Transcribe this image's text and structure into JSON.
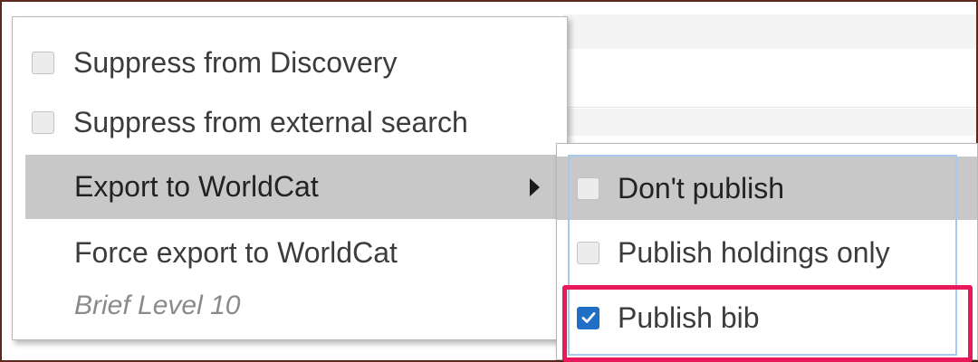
{
  "main_menu": {
    "items": [
      {
        "label": "Suppress from Discovery",
        "checked": false
      },
      {
        "label": "Suppress from external search",
        "checked": false
      },
      {
        "label": "Export to WorldCat",
        "has_submenu": true,
        "active": true
      },
      {
        "label": "Force export to WorldCat"
      },
      {
        "label": "Brief Level 10",
        "disabled": true
      }
    ]
  },
  "submenu": {
    "items": [
      {
        "label": "Don't publish",
        "checked": false,
        "active": true
      },
      {
        "label": "Publish holdings only",
        "checked": false
      },
      {
        "label": "Publish bib",
        "checked": true
      }
    ]
  },
  "colors": {
    "highlight_box": "#e8195a",
    "checkbox_checked": "#1f6fc5",
    "active_row": "#c8c8c8"
  }
}
